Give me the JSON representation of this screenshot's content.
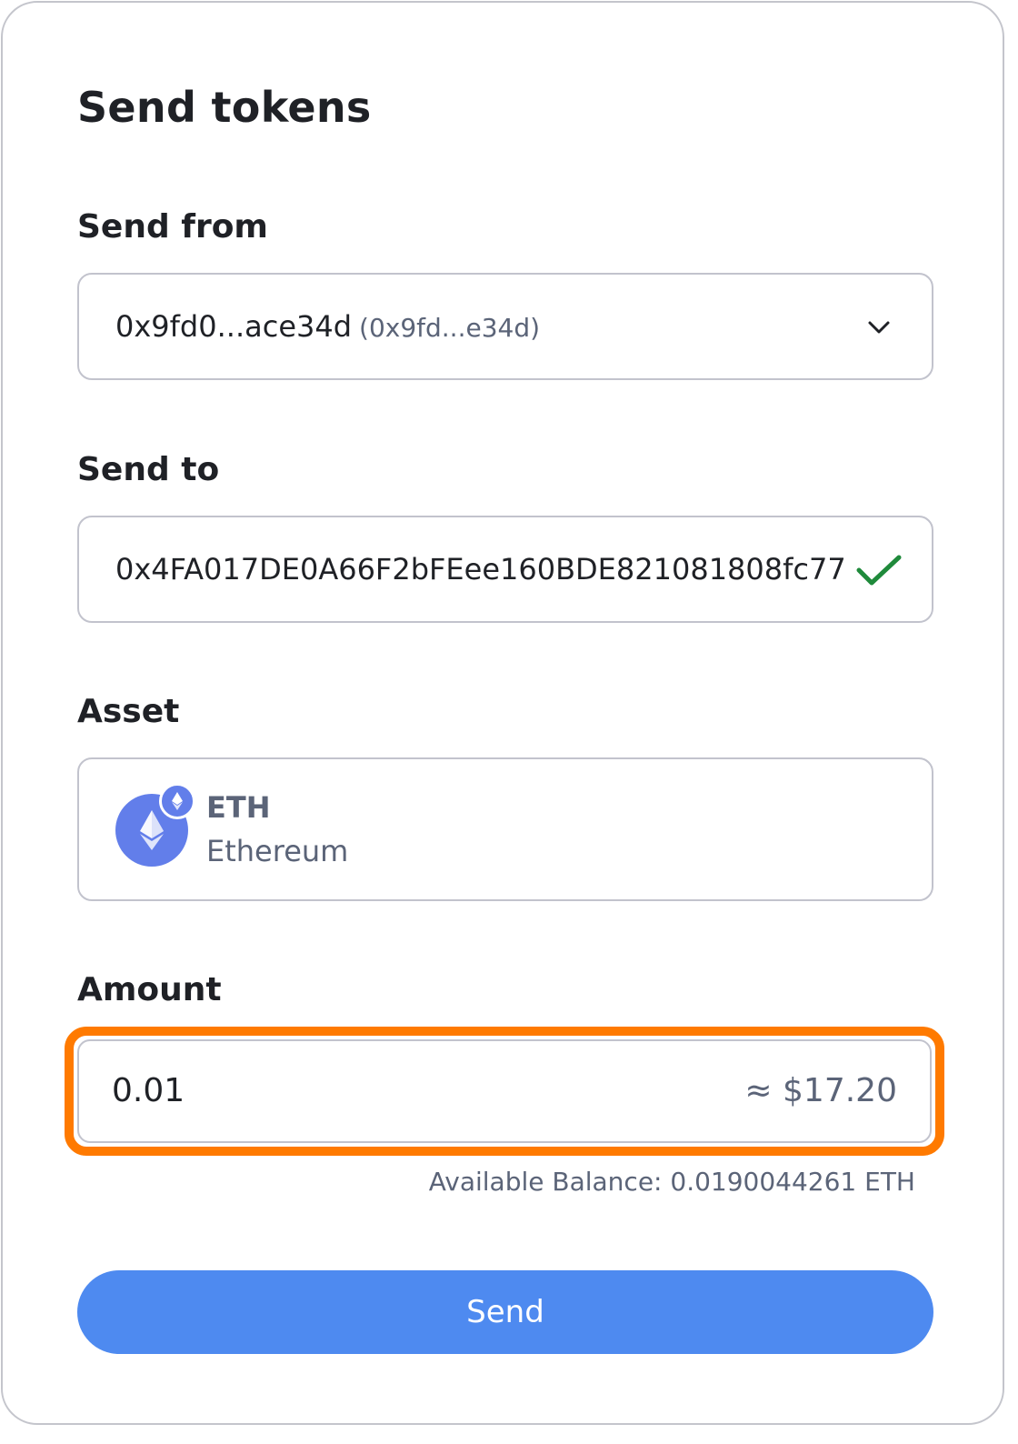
{
  "title": "Send tokens",
  "send_from": {
    "label": "Send from",
    "account_name": "0x9fd0...ace34d",
    "account_address": "(0x9fd...e34d)",
    "dropdown_icon": "chevron-down-icon"
  },
  "send_to": {
    "label": "Send to",
    "value": "0x4FA017DE0A66F2bFEee160BDE821081808fc77",
    "status_icon": "checkmark-icon",
    "status_color": "#1f8a3b"
  },
  "asset": {
    "label": "Asset",
    "symbol": "ETH",
    "name": "Ethereum",
    "icon": "ethereum-icon",
    "icon_color": "#627eea"
  },
  "amount": {
    "label": "Amount",
    "value": "0.01",
    "fiat_estimate": "≈ $17.20",
    "highlight_color": "#ff7a00"
  },
  "balance_text": "Available Balance: 0.0190044261 ETH",
  "send_button": {
    "label": "Send",
    "color": "#4e8af0"
  }
}
